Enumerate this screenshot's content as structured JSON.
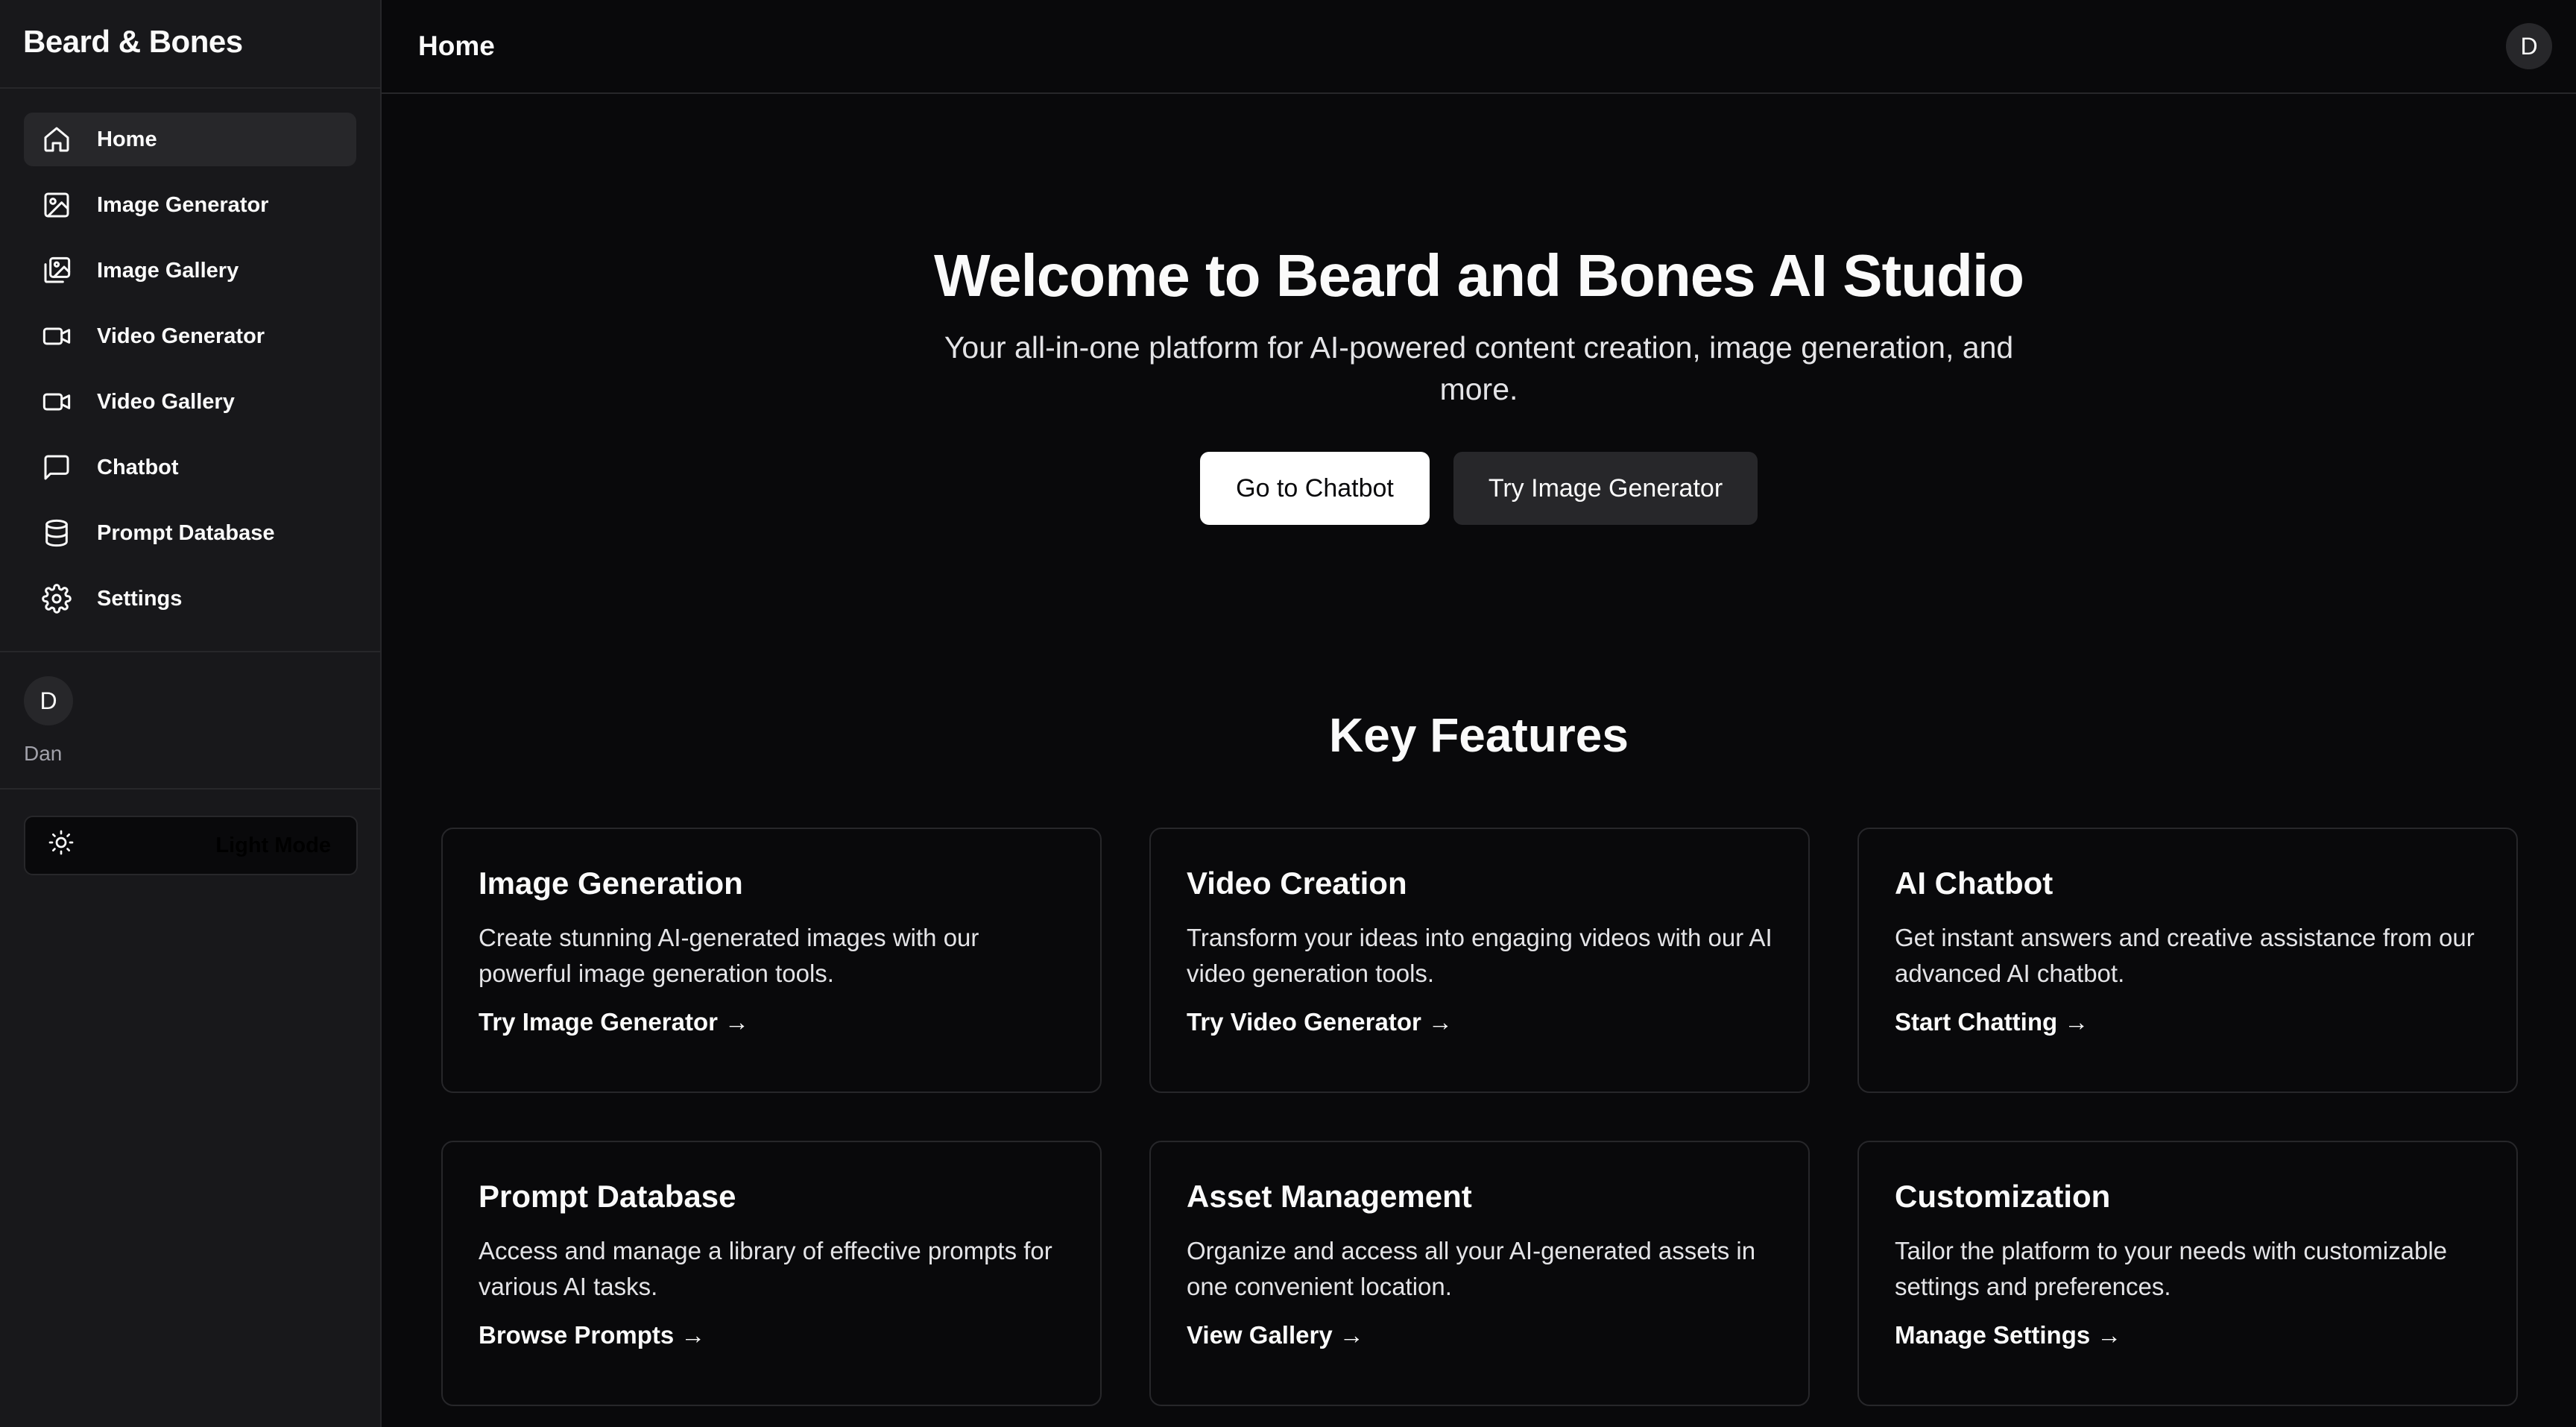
{
  "app": {
    "brand": "Beard & Bones"
  },
  "sidebar": {
    "items": [
      {
        "label": "Home",
        "icon": "home-icon"
      },
      {
        "label": "Image Generator",
        "icon": "image-icon"
      },
      {
        "label": "Image Gallery",
        "icon": "images-icon"
      },
      {
        "label": "Video Generator",
        "icon": "video-icon"
      },
      {
        "label": "Video Gallery",
        "icon": "video-icon"
      },
      {
        "label": "Chatbot",
        "icon": "message-square-icon"
      },
      {
        "label": "Prompt Database",
        "icon": "database-icon"
      },
      {
        "label": "Settings",
        "icon": "gear-icon"
      }
    ],
    "user": {
      "initial": "D",
      "name": "Dan"
    },
    "mode_toggle": {
      "label": "Light Mode",
      "icon": "sun-icon"
    }
  },
  "header": {
    "title": "Home",
    "avatar_initial": "D"
  },
  "hero": {
    "title": "Welcome to Beard and Bones AI Studio",
    "subtitle": "Your all-in-one platform for AI-powered content creation, image generation, and more.",
    "primary_button": "Go to Chatbot",
    "secondary_button": "Try Image Generator"
  },
  "features": {
    "title": "Key Features",
    "cards": [
      {
        "title": "Image Generation",
        "description": "Create stunning AI-generated images with our powerful image generation tools.",
        "link": "Try Image Generator →"
      },
      {
        "title": "Video Creation",
        "description": "Transform your ideas into engaging videos with our AI video generation tools.",
        "link": "Try Video Generator →"
      },
      {
        "title": "AI Chatbot",
        "description": "Get instant answers and creative assistance from our advanced AI chatbot.",
        "link": "Start Chatting →"
      },
      {
        "title": "Prompt Database",
        "description": "Access and manage a library of effective prompts for various AI tasks.",
        "link": "Browse Prompts →"
      },
      {
        "title": "Asset Management",
        "description": "Organize and access all your AI-generated assets in one convenient location.",
        "link": "View Gallery →"
      },
      {
        "title": "Customization",
        "description": "Tailor the platform to your needs with customizable settings and preferences.",
        "link": "Manage Settings →"
      }
    ]
  },
  "colors": {
    "background": "#09090b",
    "sidebar": "#18181b",
    "border": "#27272a",
    "text": "#fafafa"
  }
}
